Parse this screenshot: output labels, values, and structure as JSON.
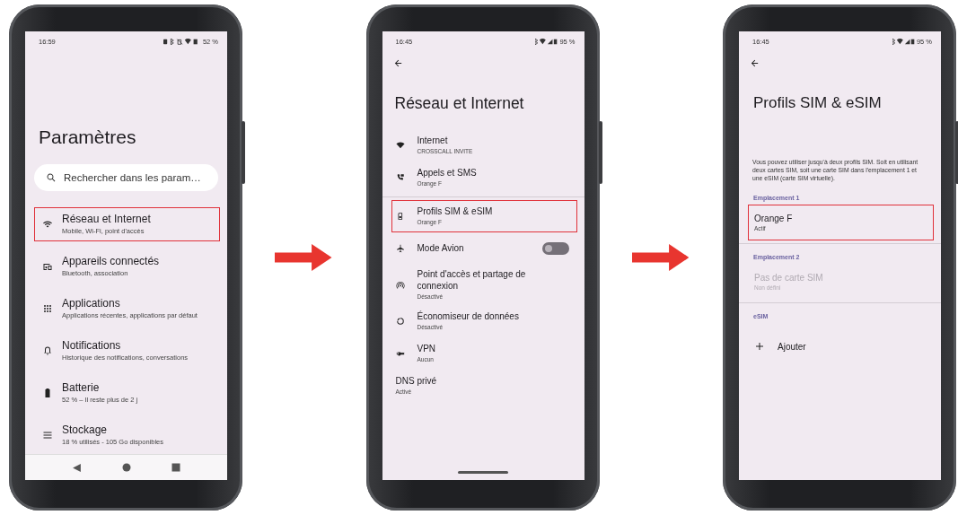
{
  "screens": [
    {
      "kind": "home",
      "time": "16:59",
      "battery": "52 %",
      "title": "Paramètres",
      "search": {
        "placeholder": "Rechercher dans les param…"
      },
      "nav_buttons": true,
      "items": [
        {
          "kind": "entry",
          "title": "Réseau et Internet",
          "subtitle": "Mobile, Wi-Fi, point d'accès",
          "highlighted": true
        },
        {
          "kind": "entry",
          "title": "Appareils connectés",
          "subtitle": "Bluetooth, association",
          "highlighted": false
        },
        {
          "kind": "entry",
          "title": "Applications",
          "subtitle": "Applications récentes, applications par défaut",
          "highlighted": false
        },
        {
          "kind": "entry",
          "title": "Notifications",
          "subtitle": "Historique des notifications, conversations",
          "highlighted": false
        },
        {
          "kind": "entry",
          "title": "Batterie",
          "subtitle": "52 % – Il reste plus de 2 j",
          "highlighted": false
        },
        {
          "kind": "entry",
          "title": "Stockage",
          "subtitle": "18 % utilisés - 105 Go disponibles",
          "highlighted": false
        }
      ]
    },
    {
      "kind": "list",
      "time": "16:45",
      "battery": "95 %",
      "title": "Réseau et Internet",
      "gesture_bar": true,
      "items": [
        {
          "kind": "entry",
          "title": "Internet",
          "subtitle": "CROSSCALL INVITE",
          "highlighted": false
        },
        {
          "kind": "entry",
          "title": "Appels et SMS",
          "subtitle": "Orange F",
          "highlighted": false
        },
        {
          "kind": "divider"
        },
        {
          "kind": "entry",
          "title": "Profils SIM & eSIM",
          "subtitle": "Orange F",
          "highlighted": true
        },
        {
          "kind": "toggle",
          "title": "Mode Avion",
          "on": false
        },
        {
          "kind": "entry",
          "title": "Point d'accès et partage de connexion",
          "subtitle": "Désactivé",
          "highlighted": false
        },
        {
          "kind": "entry",
          "title": "Économiseur de données",
          "subtitle": "Désactivé",
          "highlighted": false
        },
        {
          "kind": "entry",
          "title": "VPN",
          "subtitle": "Aucun",
          "highlighted": false
        },
        {
          "kind": "entry",
          "title": "DNS privé",
          "subtitle": "Activé",
          "highlighted": false
        }
      ]
    },
    {
      "kind": "list",
      "time": "16:45",
      "battery": "95 %",
      "title": "Profils SIM & eSIM",
      "items": [
        {
          "kind": "text",
          "text": "Vous pouvez utiliser jusqu'à deux profils SIM. Soit en utilisant deux cartes SIM, soit une carte SIM dans l'emplacement 1 et une eSIM (carte SIM virtuelle)."
        },
        {
          "kind": "section",
          "title": "Emplacement 1"
        },
        {
          "kind": "entry",
          "title": "Orange F",
          "subtitle": "Actif",
          "highlighted": true,
          "disabled": false
        },
        {
          "kind": "divider"
        },
        {
          "kind": "section",
          "title": "Emplacement 2"
        },
        {
          "kind": "entry",
          "title": "Pas de carte SIM",
          "subtitle": "Non défini",
          "highlighted": false,
          "disabled": true
        },
        {
          "kind": "divider"
        },
        {
          "kind": "section",
          "title": "eSIM"
        },
        {
          "kind": "add",
          "title": "Ajouter"
        }
      ]
    }
  ]
}
